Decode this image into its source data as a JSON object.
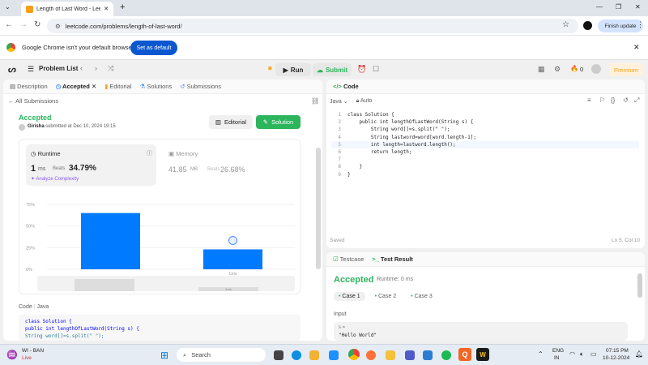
{
  "browser": {
    "tab_title": "Length of Last Word - LeetCod",
    "url": "leetcode.com/problems/length-of-last-word/",
    "finish_update": "Finish update",
    "info_text": "Google Chrome isn't your default browser",
    "set_default": "Set as default"
  },
  "header": {
    "problem_list": "Problem List",
    "run": "Run",
    "submit": "Submit",
    "fire_count": "0",
    "premium": "Premium"
  },
  "left_tabs": [
    {
      "label": "Description"
    },
    {
      "label": "Accepted"
    },
    {
      "label": "Editorial"
    },
    {
      "label": "Solutions"
    },
    {
      "label": "Submissions"
    }
  ],
  "submission": {
    "all_submissions": "All Submissions",
    "status": "Accepted",
    "user": "Girisha",
    "submitted_text": "submitted at Dec 10, 2024 19:15",
    "editorial_btn": "Editorial",
    "solution_btn": "Solution",
    "runtime_label": "Runtime",
    "runtime_value": "1",
    "runtime_unit": "ms",
    "beats_label": "Beats",
    "runtime_beats": "34.79%",
    "analyze": "Analyze Complexity",
    "memory_label": "Memory",
    "memory_value": "41.85",
    "memory_unit": "MB",
    "memory_beats": "26.68%",
    "code_label": "Code",
    "code_lang": "Java"
  },
  "chart_data": {
    "type": "bar",
    "y_ticks": [
      "75%",
      "50%",
      "25%",
      "0%"
    ],
    "ylim": [
      0,
      75
    ],
    "bars": [
      {
        "value": 65,
        "label": ""
      },
      {
        "value": 23,
        "label": "1ms"
      }
    ],
    "scroll_labels": [
      "",
      "1ms"
    ]
  },
  "editor": {
    "tab_label": "Code",
    "lang": "Java",
    "mode": "Auto",
    "saved": "Saved",
    "cursor": "Ln 5, Col 10",
    "lines": [
      "class Solution {",
      "    public int lengthOfLastWord(String s) {",
      "        String word[]=s.split(\" \");",
      "        String lastword=word[word.length-1];",
      "        int length=lastword.length();",
      "        return length;",
      "",
      "    }",
      "}"
    ]
  },
  "testpanel": {
    "tab_testcase": "Testcase",
    "tab_result": "Test Result",
    "status": "Accepted",
    "runtime": "Runtime: 0 ms",
    "cases": [
      "Case 1",
      "Case 2",
      "Case 3"
    ],
    "input_label": "Input",
    "input_var": "s =",
    "input_value": "\"Hello World\""
  },
  "left_code": {
    "line1": "class Solution {",
    "line2": "    public int lengthOfLastWord(String s) {",
    "line3": "        String word[]=s.split(\" \");"
  },
  "taskbar": {
    "weather": "WI - BAN",
    "weather_sub": "Live",
    "search": "Search",
    "lang": "ENG",
    "lang_sub": "IN",
    "time": "07:15 PM",
    "date": "10-12-2024"
  },
  "colors": {
    "accent_green": "#2db55d",
    "accent_blue": "#007aff",
    "brand_orange": "#ffa116"
  }
}
